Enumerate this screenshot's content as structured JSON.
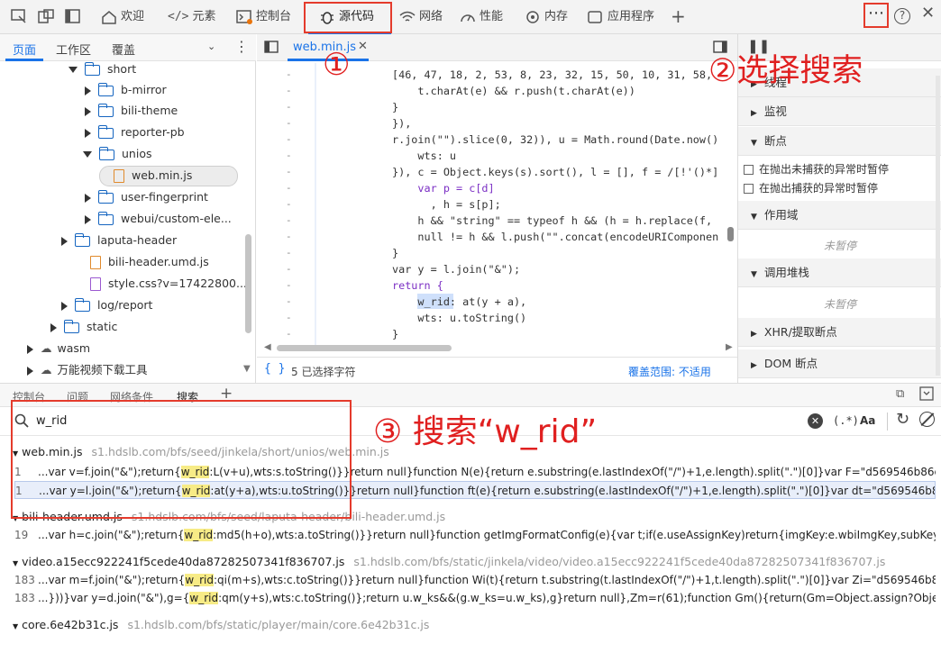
{
  "toolbar": {
    "tabs": [
      "欢迎",
      "元素",
      "控制台",
      "源代码",
      "网络",
      "性能",
      "内存",
      "应用程序"
    ],
    "more_icon": "ellipsis-icon",
    "help_icon": "help-icon",
    "close_icon": "close-icon"
  },
  "left_panel": {
    "tabs": [
      "页面",
      "工作区",
      "覆盖"
    ],
    "tree": [
      {
        "label": "short",
        "type": "folder",
        "open": true
      },
      {
        "label": "b-mirror",
        "type": "folder"
      },
      {
        "label": "bili-theme",
        "type": "folder"
      },
      {
        "label": "reporter-pb",
        "type": "folder"
      },
      {
        "label": "unios",
        "type": "folder",
        "open": true
      },
      {
        "label": "web.min.js",
        "type": "file",
        "selected": true
      },
      {
        "label": "user-fingerprint",
        "type": "folder"
      },
      {
        "label": "webui/custom-ele...",
        "type": "folder"
      },
      {
        "label": "laputa-header",
        "type": "folder"
      },
      {
        "label": "bili-header.umd.js",
        "type": "file"
      },
      {
        "label": "style.css?v=17422800...",
        "type": "css"
      },
      {
        "label": "log/report",
        "type": "folder"
      },
      {
        "label": "static",
        "type": "folder"
      },
      {
        "label": "wasm",
        "type": "cloud"
      },
      {
        "label": "万能视频下载工具",
        "type": "cloud"
      }
    ]
  },
  "editor": {
    "tab": "web.min.js",
    "lines": [
      "[46, 47, 18, 2, 53, 8, 23, 32, 15, 50, 10, 31, 58,",
      "    t.charAt(e) && r.push(t.charAt(e))",
      "}",
      "}),",
      "r.join(\"\").slice(0, 32)), u = Math.round(Date.now()",
      "    wts: u",
      "}), c = Object.keys(s).sort(), l = [], f = /[!'()*]",
      "    var p = c[d]",
      "      , h = s[p];",
      "    h && \"string\" == typeof h && (h = h.replace(f,",
      "    null != h && l.push(\"\".concat(encodeURIComponen",
      "}",
      "var y = l.join(\"&\");",
      "return {",
      "    w_rid: at(y + a),",
      "    wts: u.toString()",
      "}"
    ],
    "status": "5 已选择字符",
    "coverage": "覆盖范围: 不适用"
  },
  "right_panel": {
    "sections": [
      "监视",
      "断点",
      "作用域",
      "调用堆栈",
      "XHR/提取断点",
      "DOM 断点"
    ],
    "checkboxes": [
      "在抛出未捕获的异常时暂停",
      "在抛出捕获的异常时暂停"
    ],
    "not_paused": "未暂停",
    "partial_label": "线程"
  },
  "drawer": {
    "tabs": [
      "控制台",
      "问题",
      "网络条件",
      "搜索"
    ],
    "search_value": "w_rid",
    "regex_label": "(.*)",
    "case_label": "Aa",
    "results": [
      {
        "file": "web.min.js",
        "url": "s1.hdslb.com/bfs/seed/jinkela/short/unios/web.min.js",
        "lines": [
          {
            "n": "1",
            "pre": "...var v=f.join(\"&\");return{",
            "hit": "w_rid",
            "post": ":L(v+u),wts:s.toString()}}return null}function N(e){return e.substring(e.lastIndexOf(\"/\")+1,e.length).split(\".\")[0]}var F=\"d569546b86c252:db:9bc7e..."
          },
          {
            "n": "1",
            "pre": "...var y=l.join(\"&\");return{",
            "hit": "w_rid",
            "post": ":at(y+a),wts:u.toString()}}return null}function ft(e){return e.substring(e.lastIndexOf(\"/\")+1,e.length).split(\".\")[0]}var dt=\"d569546b86c252:db:9bc7..."
          }
        ]
      },
      {
        "file": "bili-header.umd.js",
        "url": "s1.hdslb.com/bfs/seed/laputa-header/bili-header.umd.js",
        "lines": [
          {
            "n": "19",
            "pre": "...var h=c.join(\"&\");return{",
            "hit": "w_rid",
            "post": ":md5(h+o),wts:a.toString()}}return null}function getImgFormatConfig(e){var t;if(e.useAssignKey)return{imgKey:e.wbiImgKey,subKey:e.wbiSubK..."
          }
        ]
      },
      {
        "file": "video.a15ecc922241f5cede40da87282507341f836707.js",
        "url": "s1.hdslb.com/bfs/static/jinkela/video/video.a15ecc922241f5cede40da87282507341f836707.js",
        "lines": [
          {
            "n": "183",
            "pre": "...var m=f.join(\"&\");return{",
            "hit": "w_rid",
            "post": ":qi(m+s),wts:c.toString()}}return null}function Wi(t){return t.substring(t.lastIndexOf(\"/\")+1,t.length).split(\".\")[0]}var Zi=\"d569546b86c252:db:9..."
          },
          {
            "n": "183",
            "pre": "...}))}var y=d.join(\"&\"),g={",
            "hit": "w_rid",
            "post": ":qm(y+s),wts:c.toString()};return u.w_ks&&(g.w_ks=u.w_ks),g}return null},Zm=r(61);function Gm(){return(Gm=Object.assign?Object.assign.bin..."
          }
        ]
      },
      {
        "file": "core.6e42b31c.js",
        "url": "s1.hdslb.com/bfs/static/player/main/core.6e42b31c.js",
        "lines": []
      }
    ]
  },
  "annotations": {
    "a1": "①",
    "a2": "②选择搜索",
    "a3": "③ 搜索“w_rid”"
  },
  "colors": {
    "accent": "#1a73e8",
    "annotation": "#e02020",
    "highlight": "#f7eb86"
  }
}
